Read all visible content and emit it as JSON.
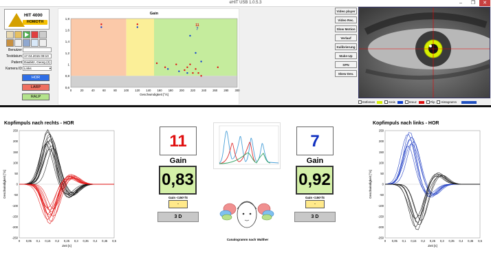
{
  "window": {
    "title": "eHIT USB 1.0.5.3",
    "controls": [
      "–",
      "❐",
      "✕"
    ]
  },
  "logo": {
    "line1": "HIT 4000",
    "line2": "HOMOTH"
  },
  "toolbar_icons": [
    "print-icon",
    "folder-icon",
    "play-icon",
    "record-icon",
    "save-icon",
    "export-icon",
    "new-icon",
    "image-icon",
    "table-icon",
    "copy-icon",
    "settings-icon",
    "delete-icon"
  ],
  "form": {
    "user_label": "Benutzer",
    "user_value": "",
    "date_label": "Testdatum",
    "date_value": "17.04.2015 09:10",
    "patient_label": "Patient",
    "patient_value": "Daubitz, Georg (2)",
    "camera_label": "Kamera ID",
    "camera_value": "Links"
  },
  "canals": [
    {
      "label": "HOR",
      "color": "#2e6ee6"
    },
    {
      "label": "LARP",
      "color": "#f07060"
    },
    {
      "label": "RALP",
      "color": "#b4e38c"
    }
  ],
  "right_buttons": [
    "Video player",
    "Video Rec.",
    "Slow Motion",
    "Verlauf",
    "Kalibrierung",
    "Make-Up",
    "SPN",
    "Skew Dev."
  ],
  "eye_controls": {
    "entfernen": "Entfernen",
    "kreis": "Kreis",
    "kreuz": "Kreuz",
    "flip": "Flip",
    "histogramm": "Histogramm",
    "kreis_color": "#d8f000",
    "kreuz_color": "#1040d0",
    "flip_color": "#e01010"
  },
  "gain_scatter": {
    "title": "Gain",
    "xlabel": "Geschwindigkeit [°/s]",
    "counts": {
      "right": "11",
      "left": "7"
    },
    "xticks": [
      "0",
      "20",
      "40",
      "60",
      "80",
      "100",
      "120",
      "140",
      "160",
      "180",
      "200",
      "220",
      "240",
      "260",
      "280",
      "300"
    ],
    "yticks": [
      "1,8",
      "1,6",
      "1,4",
      "1,2",
      "1",
      "0,8",
      "0,6"
    ]
  },
  "left_panel": {
    "title": "Kopfimpuls nach rechts - HOR",
    "count": "11",
    "count_color": "#e01010",
    "gain_label": "Gain",
    "gain_value": "0,83",
    "sub_label": "Gain <150°/S",
    "sub_value": "-",
    "d3": "3 D"
  },
  "right_panel": {
    "title": "Kopfimpuls nach links - HOR",
    "count": "7",
    "count_color": "#1030c0",
    "gain_label": "Gain",
    "gain_value": "0,92",
    "sub_label": "Gain <150°/S",
    "sub_value": "-",
    "d3": "3 D"
  },
  "canalogram_caption": "Canalogramm nach Walther",
  "head_plot": {
    "ylabel": "Geschwindigkeit [°/s]",
    "xlabel": "Zeit [s]",
    "yticks": [
      "250",
      "200",
      "150",
      "100",
      "50",
      "0",
      "-50",
      "-100",
      "-150",
      "-200",
      "-250"
    ],
    "xticks": [
      "0",
      "0,05",
      "0,1",
      "0,15",
      "0,2",
      "0,25",
      "0,3",
      "0,35",
      "0,4",
      "0,45",
      "0,5"
    ]
  },
  "chart_data": [
    {
      "type": "scatter",
      "title": "Gain",
      "xlabel": "Geschwindigkeit [°/s]",
      "xlim": [
        0,
        300
      ],
      "ylim": [
        0.6,
        1.8
      ],
      "series": [
        {
          "color": "#e01010",
          "points": [
            [
              155,
              1.02
            ],
            [
              170,
              0.95
            ],
            [
              190,
              1.0
            ],
            [
              205,
              0.9
            ],
            [
              210,
              0.95
            ],
            [
              215,
              1.0
            ],
            [
              220,
              0.85
            ],
            [
              225,
              0.92
            ],
            [
              230,
              0.85
            ],
            [
              235,
              0.8
            ],
            [
              265,
              0.95
            ],
            [
              55,
              1.7
            ],
            [
              120,
              1.7
            ]
          ]
        },
        {
          "color": "#1040d0",
          "points": [
            [
              175,
              0.92
            ],
            [
              195,
              0.88
            ],
            [
              215,
              1.5
            ],
            [
              225,
              1.2
            ],
            [
              235,
              1.05
            ],
            [
              210,
              0.85
            ],
            [
              55,
              1.65
            ],
            [
              120,
              1.65
            ]
          ]
        }
      ]
    },
    {
      "type": "line",
      "title": "Kopfimpuls nach rechts - HOR",
      "xlabel": "Zeit [s]",
      "ylabel": "Geschwindigkeit [°/s]",
      "xlim": [
        0,
        0.5
      ],
      "ylim": [
        -250,
        250
      ],
      "series": [
        {
          "color": "#111111",
          "peaks": [
            255,
            245,
            235,
            225,
            215,
            205,
            200,
            190,
            180,
            170,
            165
          ],
          "peak_t": [
            0.15,
            0.15,
            0.16,
            0.16,
            0.17,
            0.16,
            0.15,
            0.14,
            0.17,
            0.18,
            0.16
          ]
        },
        {
          "color": "#e01010",
          "peaks": [
            -185,
            -175,
            -165,
            -155,
            -150,
            -145,
            -140,
            -130,
            -120,
            -115,
            -110
          ],
          "peak_t": [
            0.16,
            0.17,
            0.15,
            0.16,
            0.18,
            0.16,
            0.15,
            0.17,
            0.16,
            0.18,
            0.15
          ]
        }
      ]
    },
    {
      "type": "line",
      "title": "Kopfimpuls nach links - HOR",
      "xlabel": "Zeit [s]",
      "ylabel": "Geschwindigkeit [°/s]",
      "xlim": [
        0,
        0.5
      ],
      "ylim": [
        -250,
        250
      ],
      "series": [
        {
          "color": "#1030c0",
          "peaks": [
            245,
            235,
            220,
            210,
            200,
            190,
            180
          ],
          "peak_t": [
            0.13,
            0.12,
            0.14,
            0.13,
            0.15,
            0.14,
            0.12
          ]
        },
        {
          "color": "#111111",
          "peaks": [
            -215,
            -200,
            -190,
            -180,
            -170,
            -160,
            -150
          ],
          "peak_t": [
            0.17,
            0.16,
            0.18,
            0.17,
            0.19,
            0.16,
            0.18
          ]
        }
      ]
    }
  ]
}
